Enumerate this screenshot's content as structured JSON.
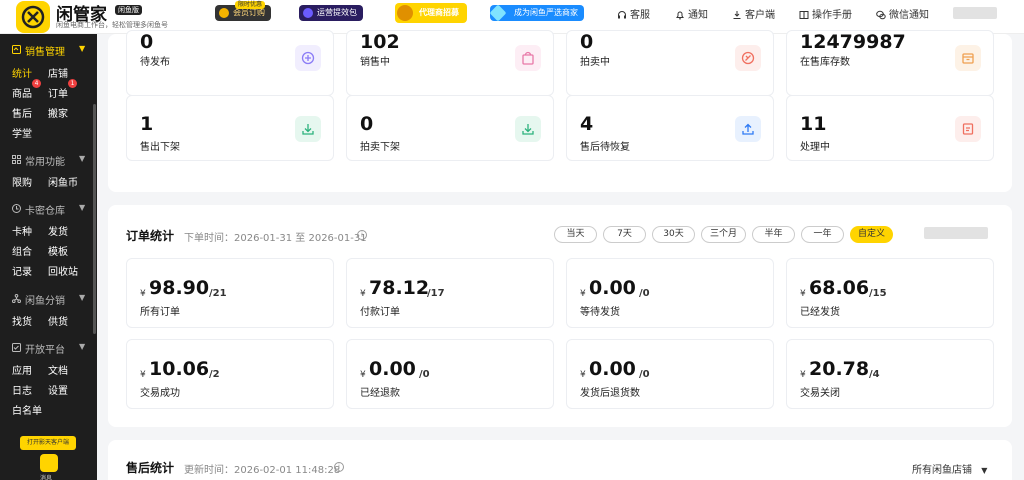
{
  "header": {
    "app_name": "闲管家",
    "version_tag": "闲鱼版",
    "tagline": "闲鱼电商工作台，轻松管理多闲鱼号",
    "promos": [
      {
        "label": "会员订购",
        "tag": "限时优惠"
      },
      {
        "label": "运营提效包"
      },
      {
        "label": "代理商招募"
      },
      {
        "label": "成为闲鱼严选商家"
      }
    ],
    "nav": [
      {
        "label": "客服",
        "icon": "headset-icon"
      },
      {
        "label": "通知",
        "icon": "bell-icon"
      },
      {
        "label": "客户端",
        "icon": "download-icon"
      },
      {
        "label": "操作手册",
        "icon": "book-icon"
      },
      {
        "label": "微信通知",
        "icon": "wechat-icon"
      }
    ]
  },
  "sidebar": {
    "sections": [
      {
        "title": "销售管理",
        "icon": "sales-icon",
        "active": true,
        "items": [
          {
            "label": "统计",
            "active": true
          },
          {
            "label": "店铺"
          },
          {
            "label": "商品",
            "badge": "4"
          },
          {
            "label": "订单",
            "badge": "1"
          },
          {
            "label": "售后"
          },
          {
            "label": "搬家"
          },
          {
            "label": "学堂"
          }
        ]
      },
      {
        "title": "常用功能",
        "icon": "grid-icon",
        "items": [
          {
            "label": "限购"
          },
          {
            "label": "闲鱼币"
          }
        ]
      },
      {
        "title": "卡密仓库",
        "icon": "warehouse-icon",
        "items": [
          {
            "label": "卡种"
          },
          {
            "label": "发货"
          },
          {
            "label": "组合"
          },
          {
            "label": "模板"
          },
          {
            "label": "记录"
          },
          {
            "label": "回收站"
          }
        ]
      },
      {
        "title": "闲鱼分销",
        "icon": "share-icon",
        "items": [
          {
            "label": "找货"
          },
          {
            "label": "供货"
          }
        ]
      },
      {
        "title": "开放平台",
        "icon": "platform-icon",
        "items": [
          {
            "label": "应用"
          },
          {
            "label": "文档"
          },
          {
            "label": "日志"
          },
          {
            "label": "设置"
          },
          {
            "label": "白名单"
          }
        ]
      }
    ],
    "cta_label": "打开影天客户端",
    "bottom_label": "消息"
  },
  "goods_stats": [
    {
      "value": "0",
      "label": "待发布",
      "icon": "plus-circle-icon",
      "color": "#8b7cf6",
      "bg": "#f1eefe"
    },
    {
      "value": "102",
      "label": "销售中",
      "icon": "bag-icon",
      "color": "#e879a8",
      "bg": "#fdeef5"
    },
    {
      "value": "0",
      "label": "拍卖中",
      "icon": "hammer-icon",
      "color": "#f07060",
      "bg": "#fdeeec"
    },
    {
      "value": "12479987",
      "label": "在售库存数",
      "icon": "box-icon",
      "color": "#f0a050",
      "bg": "#fdf2e6"
    },
    {
      "value": "1",
      "label": "售出下架",
      "icon": "download-tray-icon",
      "color": "#2db27d",
      "bg": "#e6f7ef"
    },
    {
      "value": "0",
      "label": "拍卖下架",
      "icon": "download-tray-icon",
      "color": "#2db27d",
      "bg": "#e6f7ef"
    },
    {
      "value": "4",
      "label": "售后待恢复",
      "icon": "upload-tray-icon",
      "color": "#2f7bf5",
      "bg": "#e8f1fe"
    },
    {
      "value": "11",
      "label": "处理中",
      "icon": "clipboard-icon",
      "color": "#f07060",
      "bg": "#fdeeec"
    }
  ],
  "order_stats": {
    "title": "订单统计",
    "time_label": "下单时间：2026-01-31 至 2026-01-31",
    "ranges": [
      "当天",
      "7天",
      "30天",
      "三个月",
      "半年",
      "一年",
      "自定义"
    ],
    "active_range": "自定义",
    "currency": "¥",
    "cards": [
      {
        "amount": "98.90",
        "count": "/21",
        "label": "所有订单"
      },
      {
        "amount": "78.12",
        "count": "/17",
        "label": "付款订单"
      },
      {
        "amount": "0.00",
        "count": "/0",
        "label": "等待发货"
      },
      {
        "amount": "68.06",
        "count": "/15",
        "label": "已经发货"
      },
      {
        "amount": "10.06",
        "count": "/2",
        "label": "交易成功"
      },
      {
        "amount": "0.00",
        "count": "/0",
        "label": "已经退款"
      },
      {
        "amount": "0.00",
        "count": "/0",
        "label": "发货后退货数"
      },
      {
        "amount": "20.78",
        "count": "/4",
        "label": "交易关闭"
      }
    ]
  },
  "after_sales": {
    "title": "售后统计",
    "time_label": "更新时间：2026-02-01 11:48:28",
    "store_select": "所有闲鱼店铺"
  }
}
